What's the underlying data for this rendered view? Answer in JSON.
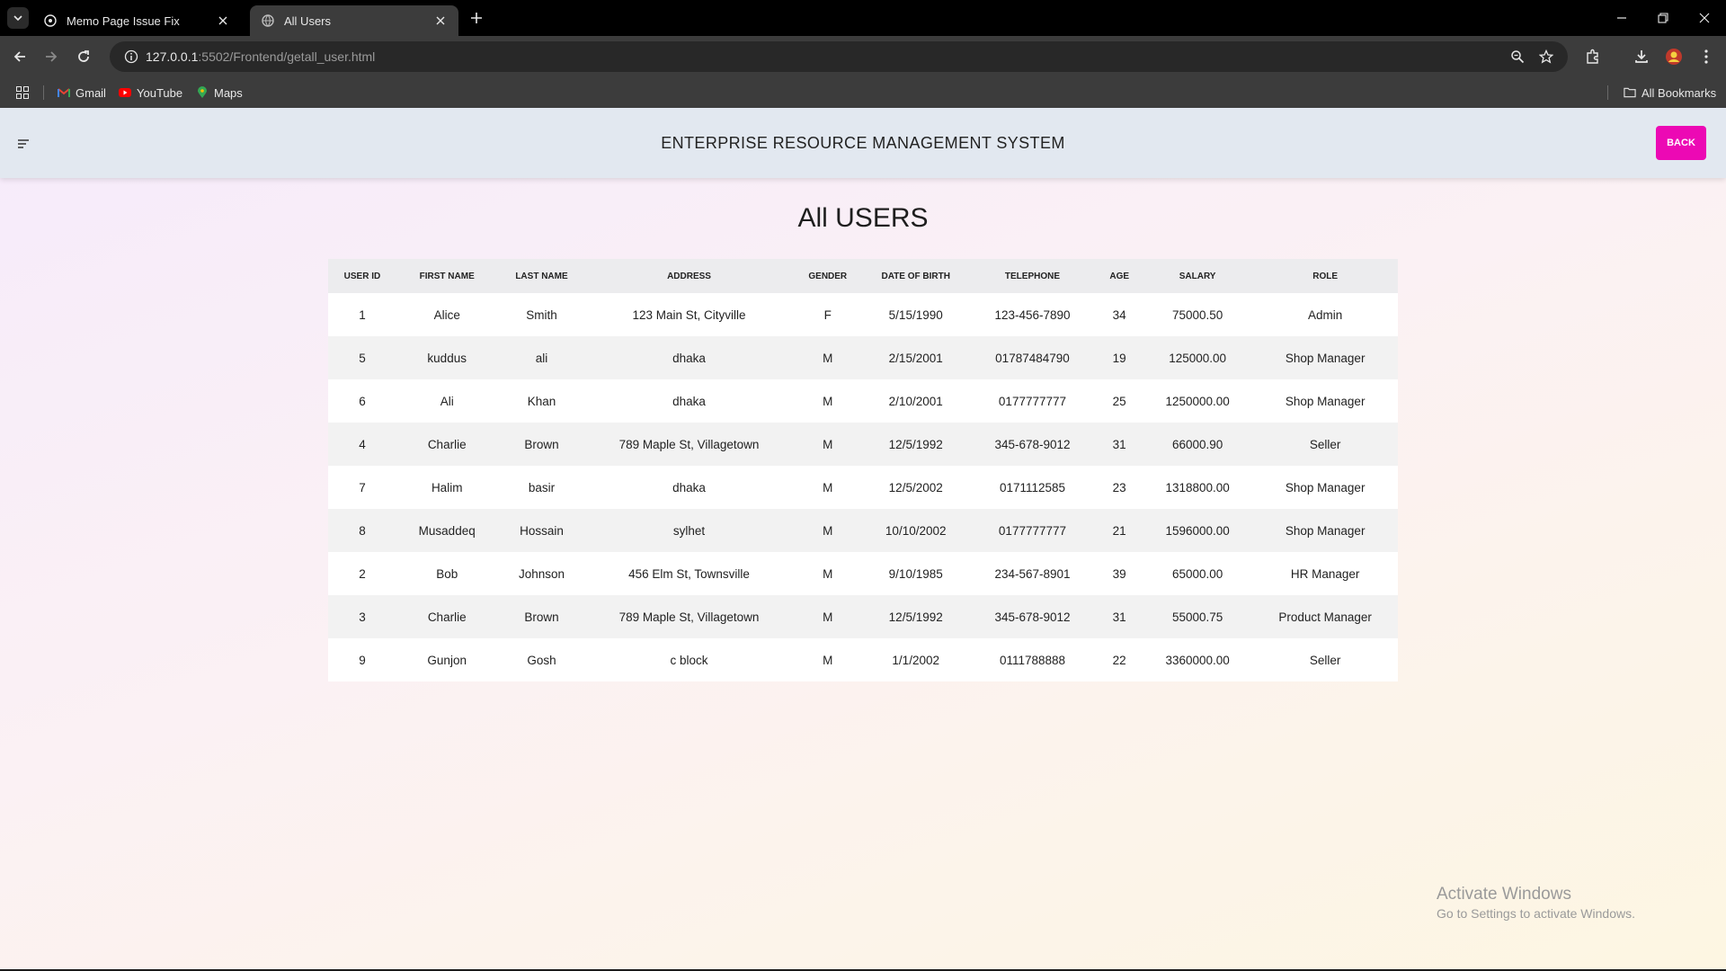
{
  "browser": {
    "tabs": [
      {
        "title": "Memo Page Issue Fix",
        "active": false
      },
      {
        "title": "All Users",
        "active": true
      }
    ],
    "url_host": "127.0.0.1",
    "url_path": ":5502/Frontend/getall_user.html",
    "bookmarks": [
      "Gmail",
      "YouTube",
      "Maps"
    ],
    "all_bookmarks": "All Bookmarks"
  },
  "header": {
    "title": "ENTERPRISE RESOURCE MANAGEMENT SYSTEM",
    "back_label": "BACK"
  },
  "main": {
    "title": "All USERS",
    "columns": [
      "USER ID",
      "FIRST NAME",
      "LAST NAME",
      "ADDRESS",
      "GENDER",
      "DATE OF BIRTH",
      "TELEPHONE",
      "AGE",
      "SALARY",
      "ROLE"
    ],
    "rows": [
      [
        "1",
        "Alice",
        "Smith",
        "123 Main St, Cityville",
        "F",
        "5/15/1990",
        "123-456-7890",
        "34",
        "75000.50",
        "Admin"
      ],
      [
        "5",
        "kuddus",
        "ali",
        "dhaka",
        "M",
        "2/15/2001",
        "01787484790",
        "19",
        "125000.00",
        "Shop Manager"
      ],
      [
        "6",
        "Ali",
        "Khan",
        "dhaka",
        "M",
        "2/10/2001",
        "0177777777",
        "25",
        "1250000.00",
        "Shop Manager"
      ],
      [
        "4",
        "Charlie",
        "Brown",
        "789 Maple St, Villagetown",
        "M",
        "12/5/1992",
        "345-678-9012",
        "31",
        "66000.90",
        "Seller"
      ],
      [
        "7",
        "Halim",
        "basir",
        "dhaka",
        "M",
        "12/5/2002",
        "0171112585",
        "23",
        "1318800.00",
        "Shop Manager"
      ],
      [
        "8",
        "Musaddeq",
        "Hossain",
        "sylhet",
        "M",
        "10/10/2002",
        "0177777777",
        "21",
        "1596000.00",
        "Shop Manager"
      ],
      [
        "2",
        "Bob",
        "Johnson",
        "456 Elm St, Townsville",
        "M",
        "9/10/1985",
        "234-567-8901",
        "39",
        "65000.00",
        "HR Manager"
      ],
      [
        "3",
        "Charlie",
        "Brown",
        "789 Maple St, Villagetown",
        "M",
        "12/5/1992",
        "345-678-9012",
        "31",
        "55000.75",
        "Product Manager"
      ],
      [
        "9",
        "Gunjon",
        "Gosh",
        "c block",
        "M",
        "1/1/2002",
        "0111788888",
        "22",
        "3360000.00",
        "Seller"
      ]
    ]
  },
  "watermark": {
    "line1": "Activate Windows",
    "line2": "Go to Settings to activate Windows."
  },
  "colors": {
    "accent": "#ec09b4",
    "header_bg": "#e2e8f0"
  }
}
